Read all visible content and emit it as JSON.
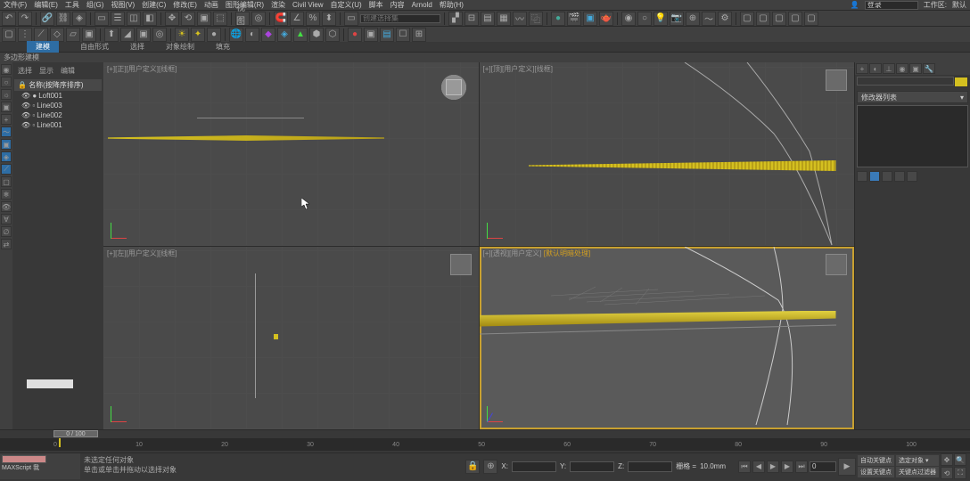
{
  "menubar": {
    "items": [
      "文件(F)",
      "编辑(E)",
      "工具",
      "组(G)",
      "视图(V)",
      "创建(C)",
      "修改(E)",
      "动画",
      "图形编辑(R)",
      "渲染",
      "Civil View",
      "自定义(U)",
      "脚本",
      "内容",
      "Arnold",
      "帮助(H)"
    ],
    "login": "登录",
    "workspace_label": "工作区:",
    "workspace_value": "默认"
  },
  "tabs": {
    "items": [
      "建模",
      "自由形式",
      "选择",
      "对象绘制",
      "填充"
    ],
    "active": 0
  },
  "sub_header": "多边形建模",
  "left": {
    "tabs": [
      "选择",
      "显示",
      "编辑"
    ],
    "header": "名称(按降序排序)",
    "items": [
      "Loft001",
      "Line003",
      "Line002",
      "Line001"
    ]
  },
  "viewports": {
    "tl": "[+][正][用户定义][线框]",
    "tr": "[+][顶][用户定义][线框]",
    "bl": "[+][左][用户定义][线框]",
    "br_prefix": "[+][透视][用户定义]",
    "br_highlight": "[默认明暗处理]"
  },
  "right": {
    "dropdown": "修改器列表"
  },
  "timeline": {
    "handle": "0 / 100",
    "ticks": [
      "0",
      "10",
      "20",
      "30",
      "40",
      "50",
      "60",
      "70",
      "80",
      "90",
      "100"
    ]
  },
  "status": {
    "script_label": "MAXScript 我",
    "msg1": "未选定任何对象",
    "msg2": "单击或单击并拖动以选择对象",
    "coord_x": "",
    "coord_y": "",
    "coord_z": "",
    "grid_label": "栅格 =",
    "grid_value": "10.0mm",
    "autokey": "自动关键点",
    "selobj": "选定对象",
    "setkey": "设置关键点",
    "keyfilter": "关键点过滤器",
    "frame": "0"
  }
}
